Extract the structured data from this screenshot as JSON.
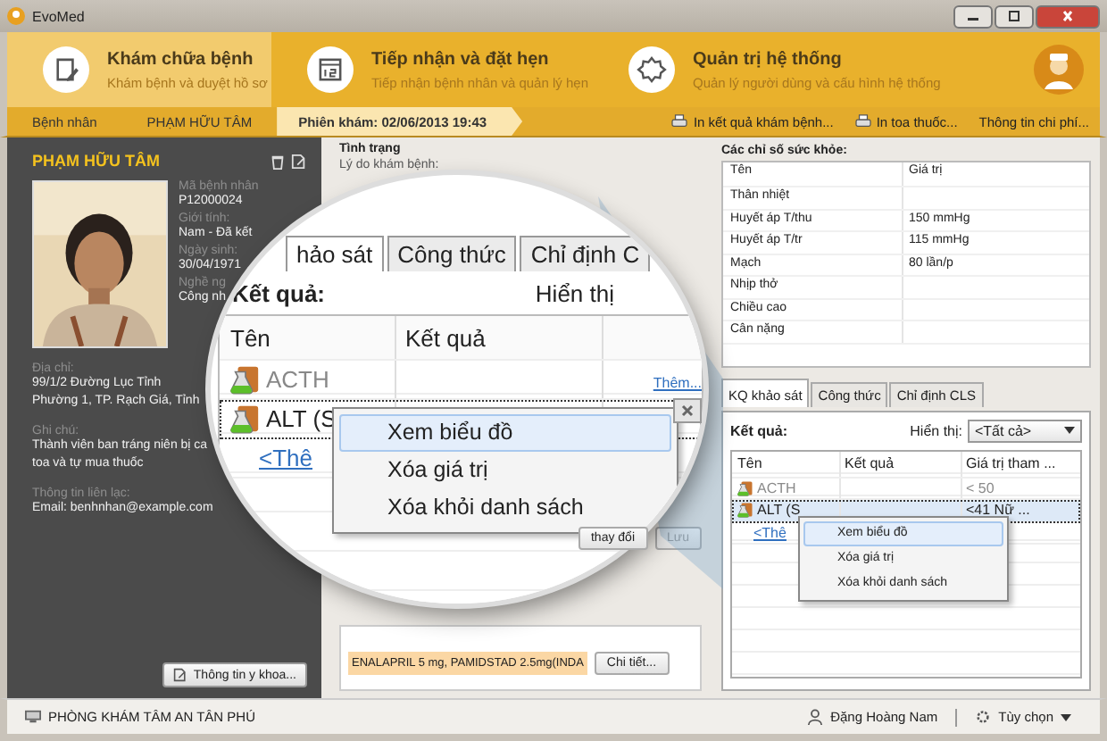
{
  "window": {
    "title": "EvoMed"
  },
  "ribbon": {
    "tabs": [
      {
        "title": "Khám chữa bệnh",
        "subtitle": "Khám bệnh và duyệt hồ sơ",
        "selected": true
      },
      {
        "title": "Tiếp nhận và đặt hẹn",
        "subtitle": "Tiếp nhận bệnh nhân và quản lý hẹn",
        "selected": false
      },
      {
        "title": "Quản trị hệ thống",
        "subtitle": "Quản lý người dùng và cấu hình hệ thống",
        "selected": false
      }
    ]
  },
  "breadcrumb": {
    "items": [
      {
        "label": "Bệnh nhân",
        "selected": false
      },
      {
        "label": "PHẠM HỮU TÂM",
        "selected": false
      },
      {
        "label": "Phiên khám: 02/06/2013 19:43",
        "selected": true
      }
    ],
    "actions": [
      "In kết quả khám bệnh...",
      "In toa thuốc...",
      "Thông tin chi phí..."
    ]
  },
  "patient": {
    "name": "PHẠM HỮU TÂM",
    "fields": [
      {
        "label": "Mã bệnh nhân",
        "value": "P12000024"
      },
      {
        "label": "Giới tính:",
        "value": "Nam - Đã kết"
      },
      {
        "label": "Ngày sinh:",
        "value": "30/04/1971"
      },
      {
        "label": "Nghề ng",
        "value": "Công nh"
      }
    ],
    "details": [
      {
        "label": "Địa chỉ:",
        "lines": [
          "99/1/2 Đường Lục Tỉnh",
          "Phường 1, TP. Rạch Giá, Tỉnh"
        ]
      },
      {
        "label": "Ghi chú:",
        "lines": [
          "Thành viên ban tráng niên bị ca",
          "toa và tự mua thuốc"
        ]
      },
      {
        "label": "Thông tin liên lạc:",
        "lines": [
          "Email: benhnhan@example.com"
        ]
      }
    ],
    "button": "Thông tin y khoa..."
  },
  "condition": {
    "title": "Tình trạng",
    "reason_label": "Lý do khám bệnh:"
  },
  "lab_box": {
    "add_link": "Thêm...",
    "save_changes": "thay đổi",
    "save": "Lưu"
  },
  "prescription": {
    "text": "ENALAPRIL 5 mg, PAMIDSTAD 2.5mg(INDA",
    "button": "Chi tiết..."
  },
  "vitals": {
    "title": "Các chỉ số sức khỏe:",
    "columns": [
      "Tên",
      "Giá trị"
    ],
    "rows": [
      {
        "name": "Thân nhiệt"
      },
      {
        "name": "Huyết áp T/thu",
        "value": "150 mmHg"
      },
      {
        "name": "Huyết áp T/tr",
        "value": "115 mmHg"
      },
      {
        "name": "Mạch",
        "value": "80 lần/p"
      },
      {
        "name": "Nhịp thở"
      },
      {
        "name": "Chiều cao"
      },
      {
        "name": "Cân nặng"
      }
    ]
  },
  "results": {
    "tabs": [
      {
        "label": "KQ khảo sát",
        "selected": true
      },
      {
        "label": "Công thức",
        "selected": false
      },
      {
        "label": "Chỉ định CLS",
        "selected": false
      }
    ],
    "result_label": "Kết quả:",
    "filter_label": "Hiển thị:",
    "filter_value": "<Tất cả>",
    "columns": [
      "Tên",
      "Kết quả",
      "Giá trị tham ..."
    ],
    "rows": [
      {
        "name": "ACTH",
        "reference": "< 50",
        "dimmed": true,
        "selected": false
      },
      {
        "name": "ALT (S",
        "reference": "<41 Nữ ...",
        "dimmed": false,
        "selected": true
      }
    ],
    "add_row": "<Thê",
    "context_menu": [
      {
        "label": "Xem biểu đồ",
        "selected": true
      },
      {
        "label": "Xóa giá trị",
        "selected": false
      },
      {
        "label": "Xóa khỏi danh sách",
        "selected": false
      }
    ]
  },
  "magnifier": {
    "tabs": [
      {
        "label": "hảo sát",
        "selected": true
      },
      {
        "label": "Công thức",
        "selected": false
      },
      {
        "label": "Chỉ định C",
        "selected": false
      }
    ],
    "result_label": "Kết quả:",
    "filter_label": "Hiển thị",
    "columns": [
      "Tên",
      "Kết quả"
    ],
    "rows": [
      {
        "name": "ACTH",
        "dimmed": true,
        "selected": false
      },
      {
        "name": "ALT (S",
        "dimmed": false,
        "selected": true
      }
    ],
    "add_row": "<Thê",
    "context_menu": [
      {
        "label": "Xem biểu đồ",
        "selected": true
      },
      {
        "label": "Xóa giá trị",
        "selected": false
      },
      {
        "label": "Xóa khỏi danh sách",
        "selected": false
      }
    ]
  },
  "status_bar": {
    "clinic": "PHÒNG KHÁM TÂM AN TÂN PHÚ",
    "user": "Đặng Hoàng Nam",
    "options": "Tùy chọn"
  }
}
